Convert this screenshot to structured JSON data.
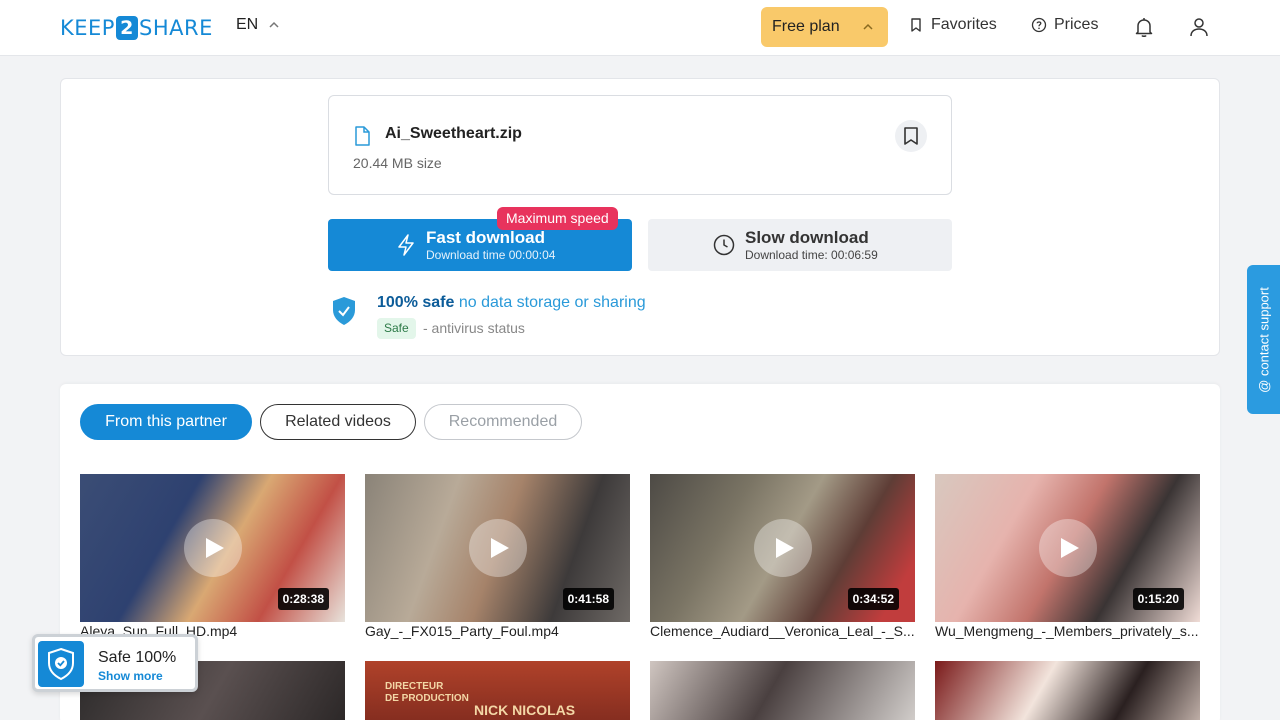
{
  "header": {
    "logo_left": "KEEP",
    "logo_mid": "2",
    "logo_right": "SHARE",
    "language": "EN",
    "free_plan": "Free plan",
    "favorites": "Favorites",
    "prices": "Prices"
  },
  "file": {
    "name": "Ai_Sweetheart.zip",
    "size": "20.44 MB size"
  },
  "download": {
    "fast_title": "Fast download",
    "fast_sub": "Download time 00:00:04",
    "max_speed_badge": "Maximum speed",
    "slow_title": "Slow download",
    "slow_sub": "Download time: 00:06:59"
  },
  "safety": {
    "strong": "100% safe",
    "rest": "no data storage or sharing",
    "badge": "Safe",
    "antivirus": "- antivirus status"
  },
  "tabs": [
    "From this partner",
    "Related videos",
    "Recommended"
  ],
  "videos": [
    {
      "title": "Aleya_Sun_Full_HD.mp4",
      "duration": "0:28:38"
    },
    {
      "title": "Gay_-_FX015_Party_Foul.mp4",
      "duration": "0:41:58"
    },
    {
      "title": "Clemence_Audiard__Veronica_Leal_-_S...",
      "duration": "0:34:52"
    },
    {
      "title": "Wu_Mengmeng_-_Members_privately_s...",
      "duration": "0:15:20"
    }
  ],
  "thumb_text": {
    "credit_role": "DIRECTEUR\nDE PRODUCTION",
    "credit_name": "NICK NICOLAS"
  },
  "contact_support": "@ contact support",
  "safe_widget": {
    "title": "Safe 100%",
    "more": "Show more"
  },
  "colors": {
    "brand_blue": "#1589d6",
    "free_plan_bg": "#f9c96a",
    "max_speed_red": "#e8335d",
    "safe_green_bg": "#e3f6ea"
  }
}
